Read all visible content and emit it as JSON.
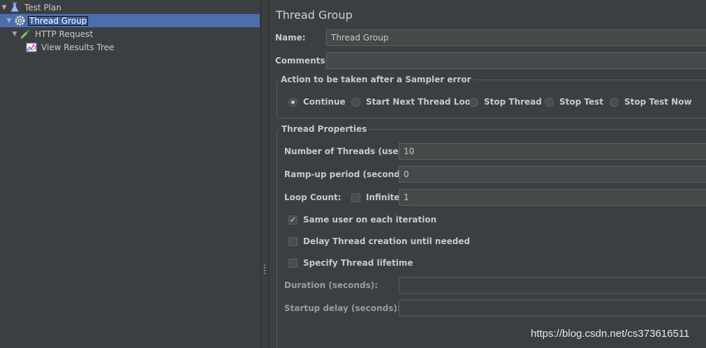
{
  "tree": {
    "items": [
      {
        "label": "Test Plan",
        "icon": "flask-icon",
        "expanded": true
      },
      {
        "label": "Thread Group",
        "icon": "gear-icon",
        "expanded": true,
        "selected": true
      },
      {
        "label": "HTTP Request",
        "icon": "pipette-icon",
        "expanded": true
      },
      {
        "label": "View Results Tree",
        "icon": "chart-icon"
      }
    ]
  },
  "panel": {
    "title": "Thread Group",
    "name_label": "Name:",
    "name_value": "Thread Group",
    "comments_label": "Comments:",
    "comments_value": "",
    "sampler_error": {
      "title": "Action to be taken after a Sampler error",
      "options": [
        {
          "label": "Continue",
          "selected": true
        },
        {
          "label": "Start Next Thread Loop",
          "selected": false
        },
        {
          "label": "Stop Thread",
          "selected": false
        },
        {
          "label": "Stop Test",
          "selected": false
        },
        {
          "label": "Stop Test Now",
          "selected": false
        }
      ]
    },
    "thread_props": {
      "title": "Thread Properties",
      "threads_label": "Number of Threads (users):",
      "threads_value": "10",
      "rampup_label": "Ramp-up period (seconds):",
      "rampup_value": "0",
      "loop_label": "Loop Count:",
      "infinite_label": "Infinite",
      "infinite_checked": false,
      "loop_value": "1",
      "same_user_label": "Same user on each iteration",
      "same_user_checked": true,
      "delay_label": "Delay Thread creation until needed",
      "delay_checked": false,
      "lifetime_label": "Specify Thread lifetime",
      "lifetime_checked": false,
      "duration_label": "Duration (seconds):",
      "duration_value": "",
      "startup_label": "Startup delay (seconds):",
      "startup_value": ""
    }
  },
  "watermark": "https://blog.csdn.net/cs373616511",
  "colors": {
    "selection": "#4b6eaf",
    "background": "#3c3f41"
  }
}
